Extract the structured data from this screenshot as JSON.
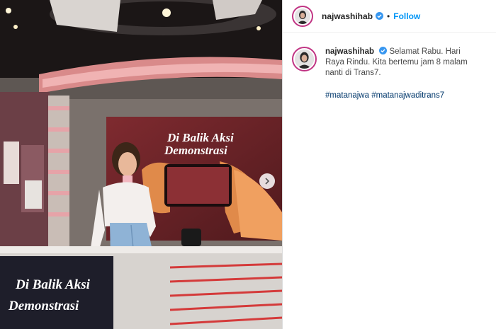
{
  "post": {
    "username": "najwashihab",
    "follow_label": "Follow",
    "separator": "•",
    "caption": {
      "text": "Selamat Rabu. Hari Raya Rindu. Kita bertemu jam 8 malam nanti di Trans7.",
      "hashtags": [
        "#matanajwa",
        "#matanajwaditrans7"
      ]
    }
  },
  "media": {
    "screen_title_line1": "Di Balik Aksi",
    "screen_title_line2": "Demonstrasi",
    "desk_title_line1": "Di Balik Aksi",
    "desk_title_line2": "Demonstrasi"
  },
  "colors": {
    "link_blue": "#0095f6",
    "hashtag": "#00376b",
    "verified": "#3897f0",
    "story_ring": "#c13584"
  },
  "icons": [
    "verified-badge-icon",
    "chevron-right-icon"
  ]
}
